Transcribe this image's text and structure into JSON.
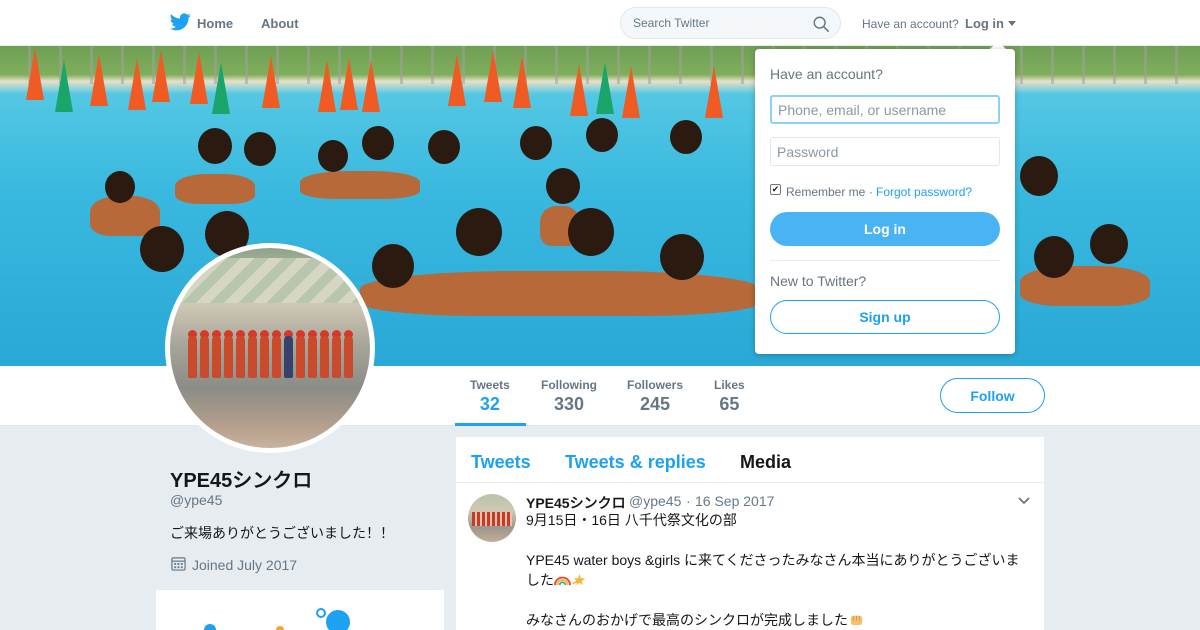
{
  "colors": {
    "accent": "#1da1f2",
    "text": "#14171a",
    "muted": "#657786",
    "background": "#e6ecf0",
    "cone_orange": "#f05a23",
    "cone_green": "#1aa66b"
  },
  "nav": {
    "logo_icon": "twitter-bird-icon",
    "home_label": "Home",
    "about_label": "About",
    "search_placeholder": "Search Twitter",
    "search_icon": "search-icon",
    "have_account_text": "Have an account?",
    "login_label": "Log in"
  },
  "profile": {
    "name": "YPE45シンクロ",
    "handle": "@ype45",
    "bio": "ご来場ありがとうございました！！",
    "joined": "Joined July 2017",
    "stats": [
      {
        "label": "Tweets",
        "value": "32"
      },
      {
        "label": "Following",
        "value": "330"
      },
      {
        "label": "Followers",
        "value": "245"
      },
      {
        "label": "Likes",
        "value": "65"
      }
    ],
    "follow_label": "Follow"
  },
  "timeline": {
    "tabs": [
      {
        "label": "Tweets"
      },
      {
        "label": "Tweets & replies"
      },
      {
        "label": "Media"
      }
    ],
    "tweet": {
      "author": "YPE45シンクロ",
      "handle": "@ype45",
      "separator": "·",
      "date": "16 Sep 2017",
      "line1": "9月15日・16日 八千代祭文化の部",
      "line2": "YPE45  water boys &girls に来てくださったみなさん本当にありがとうございま",
      "line3": "した",
      "line4": "みなさんのおかげで最高のシンクロが完成しました",
      "emojis": [
        "rainbow-emoji",
        "dizzy-emoji",
        "fist-emoji"
      ]
    }
  },
  "login_dropdown": {
    "title": "Have an account?",
    "username_placeholder": "Phone, email, or username",
    "password_placeholder": "Password",
    "remember_label": "Remember me",
    "remember_checked": true,
    "separator": "·",
    "forgot_label": "Forgot password?",
    "login_button": "Log in",
    "new_text": "New to Twitter?",
    "signup_button": "Sign up"
  }
}
